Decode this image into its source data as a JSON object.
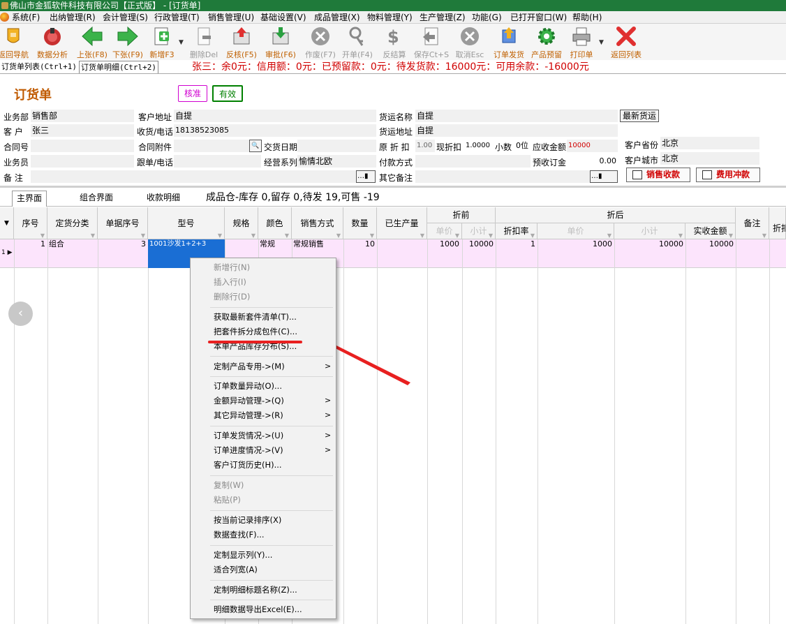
{
  "window": {
    "title": "佛山市金狐软件科技有限公司【正式版】 - [订货单]"
  },
  "menu": [
    "系统(F)",
    "出纳管理(R)",
    "会计管理(S)",
    "行政管理(T)",
    "销售管理(U)",
    "基础设置(V)",
    "成品管理(X)",
    "物料管理(Y)",
    "生产管理(Z)",
    "功能(G)",
    "已打开窗口(W)",
    "帮助(H)"
  ],
  "toolbar": {
    "back_nav": "返回导航",
    "analysis": "数据分析",
    "prev": "上张(F8)",
    "next": "下张(F9)",
    "new": "新增F3",
    "delete": "删除Del",
    "review": "反核(F5)",
    "approve": "审批(F6)",
    "void": "作废(F7)",
    "open": "开单(F4)",
    "reverse_settle": "反结算",
    "save": "保存Ct+S",
    "cancel": "取消Esc",
    "ship": "订单发货",
    "warning": "产品预留",
    "print": "打印单",
    "back_list": "返回列表"
  },
  "tabs": {
    "list": "订货单列表(Ctrl+1)",
    "detail": "订货单明细(Ctrl+2)"
  },
  "status": "张三：余0元：信用额：0元：已预留款：0元：待发货款：16000元：可用余款：-16000元",
  "form": {
    "title": "订货单",
    "badge_approve": "核准",
    "badge_valid": "有效",
    "dept_label": "业务部",
    "dept": "销售部",
    "cust_label": "客 户",
    "cust": "张三",
    "contract_label": "合同号",
    "contract": "",
    "salesman_label": "业务员",
    "salesman": "",
    "remark_label": "备 注",
    "remark": "",
    "addr_label": "客户地址",
    "addr": "自提",
    "phone_label": "收货/电话",
    "phone": "18138523085",
    "attach_label": "合同附件",
    "attach": "",
    "follow_label": "跟单/电话",
    "follow": "",
    "delivery_date_label": "交货日期",
    "delivery_date": "",
    "series_label": "经营系列",
    "series": "愉情北欧",
    "ship_name_label": "货运名称",
    "ship_name": "自提",
    "ship_addr_label": "货运地址",
    "ship_addr": "自提",
    "discount_label": "原 折 扣",
    "discount": "1.00",
    "cur_discount_label": "现折扣",
    "cur_discount": "1.0000",
    "decimal_label": "小数",
    "decimal": "0位",
    "receivable_label": "应收金额",
    "receivable": "10000",
    "pay_label": "付款方式",
    "pay": "",
    "deposit_label": "预收订金",
    "deposit": "0.00",
    "other_remark_label": "其它备注",
    "other_remark": "",
    "latest_ship_btn": "最新货运",
    "province_label": "客户省份",
    "province": "北京",
    "city_label": "客户城市",
    "city": "北京",
    "sale_receipt_btn": "销售收款",
    "fee_offset_btn": "费用冲款"
  },
  "subtabs": {
    "main": "主界面",
    "combo": "组合界面",
    "payment": "收款明细"
  },
  "stock_info": "成品仓-库存 0,留存 0,待发 19,可售 -19",
  "table": {
    "headers": {
      "seq": "序号",
      "category": "定货分类",
      "doc_seq": "单据序号",
      "model": "型号",
      "spec": "规格",
      "color": "颜色",
      "sale_mode": "销售方式",
      "qty": "数量",
      "produced": "已生产量",
      "before": "折前",
      "price": "单价",
      "subtotal": "小计",
      "after": "折后",
      "rate": "折扣率",
      "after_price": "单价",
      "after_subtotal": "小计",
      "actual": "实收金额",
      "note": "备注",
      "extra": "折扣"
    },
    "row": {
      "seq": "1",
      "category": "组合",
      "doc_seq": "3",
      "model": "1001沙发1+2+3",
      "spec": "",
      "color": "常规",
      "sale_mode": "常规销售",
      "qty": "10",
      "produced": "",
      "price": "1000",
      "subtotal": "10000",
      "rate": "1",
      "after_price": "1000",
      "after_subtotal": "10000",
      "actual": "10000",
      "row_num": "1"
    }
  },
  "context_menu": {
    "new_row": "新增行(N)",
    "insert_row": "插入行(I)",
    "delete_row": "删除行(D)",
    "get_kit": "获取最新套件清单(T)...",
    "split_kit": "把套件拆分成包件(C)...",
    "stock_dist": "本单产品库存分布(S)...",
    "custom_product": "定制产品专用->(M)",
    "qty_change": "订单数量异动(O)...",
    "amount_change": "金额异动管理->(Q)",
    "other_change": "其它异动管理->(R)",
    "ship_status": "订单发货情况->(U)",
    "progress": "订单进度情况->(V)",
    "history": "客户订货历史(H)...",
    "copy": "复制(W)",
    "paste": "粘贴(P)",
    "sort": "按当前记录排序(X)",
    "find": "数据查找(F)...",
    "custom_cols": "定制显示列(Y)...",
    "fit_width": "适合列宽(A)",
    "custom_title": "定制明细标题名称(Z)...",
    "export": "明细数据导出Excel(E)...",
    "submenu_arrow": ">"
  }
}
